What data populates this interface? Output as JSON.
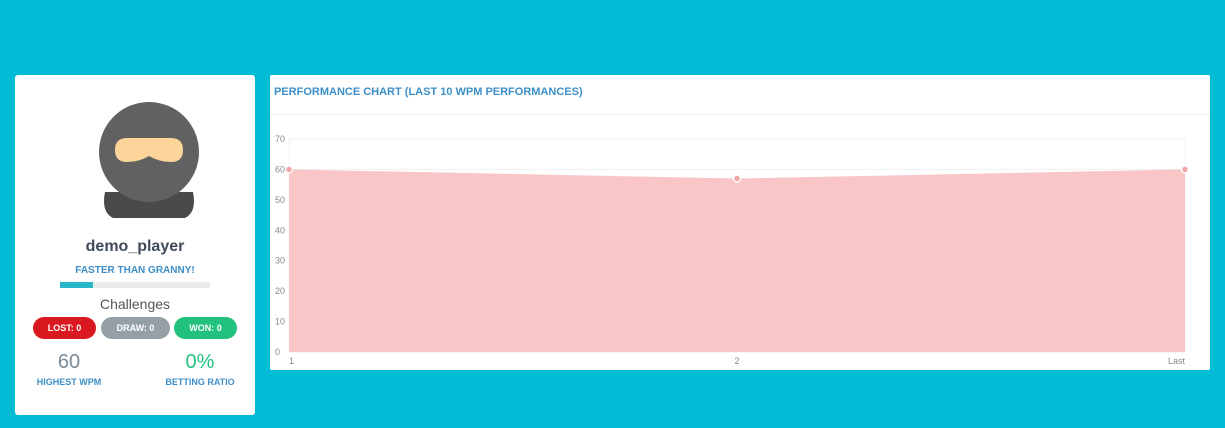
{
  "profile": {
    "username": "demo_player",
    "rank": "FASTER THAN GRANNY!",
    "progress": 0.22,
    "challenges_title": "Challenges",
    "lost": "LOST: 0",
    "draw": "DRAW: 0",
    "won": "WON: 0",
    "highest_wpm_value": "60",
    "highest_wpm_label": "HIGHEST WPM",
    "betting_ratio_value": "0%",
    "betting_ratio_label": "BETTING RATIO"
  },
  "chart": {
    "title": "PERFORMANCE CHART (LAST 10 WPM PERFORMANCES)"
  },
  "chart_data": {
    "type": "area",
    "categories": [
      "1",
      "2",
      "Last"
    ],
    "values": [
      60,
      57,
      60
    ],
    "yticks": [
      0,
      10,
      20,
      30,
      40,
      50,
      60,
      70
    ],
    "ylim": [
      0,
      70
    ],
    "grid": true,
    "fill_color": "#f9c5c6",
    "point_color": "#f2a5a7"
  },
  "colors": {
    "background": "#00bcd4",
    "accent": "#3d8fc8",
    "lost": "#d9191f",
    "draw": "#94a0a6",
    "won": "#22c27e"
  }
}
